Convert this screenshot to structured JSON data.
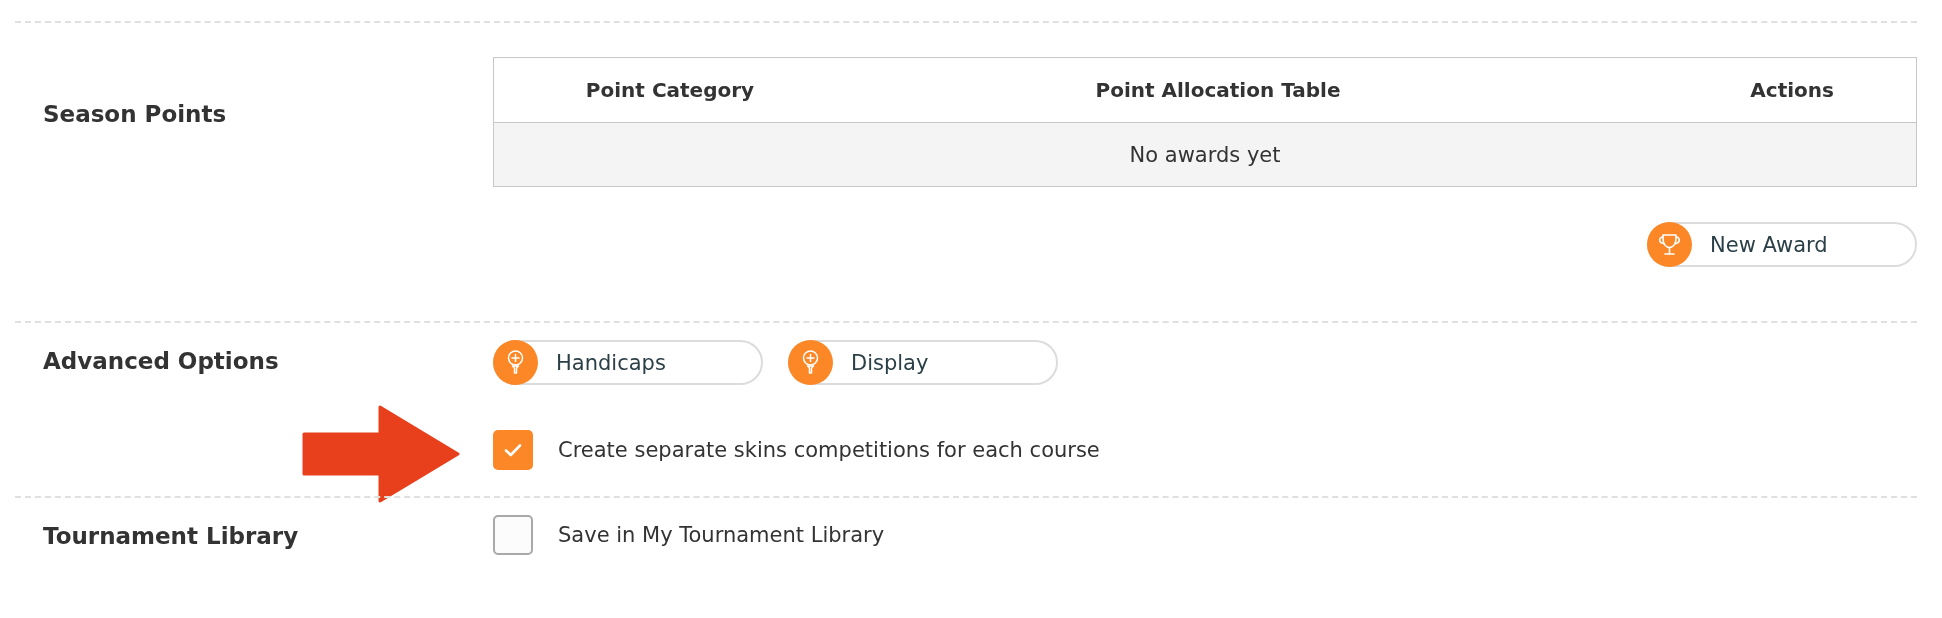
{
  "sections": [
    {
      "kind": "table",
      "label": "Season Points",
      "table": {
        "columns": [
          "Point Category",
          "Point Allocation Table",
          "Actions"
        ],
        "empty_message": "No awards yet"
      },
      "buttons": [
        "New Award"
      ]
    },
    {
      "kind": "options",
      "label": "Advanced Options",
      "buttons": [
        "Handicaps",
        "Display"
      ],
      "checkbox": {
        "label": "Create separate skins competitions for each course",
        "checked": true,
        "callout_arrow": true
      }
    },
    {
      "kind": "checkbox",
      "label": "Tournament Library",
      "checkbox": {
        "label": "Save in My Tournament Library",
        "checked": false
      }
    }
  ]
}
